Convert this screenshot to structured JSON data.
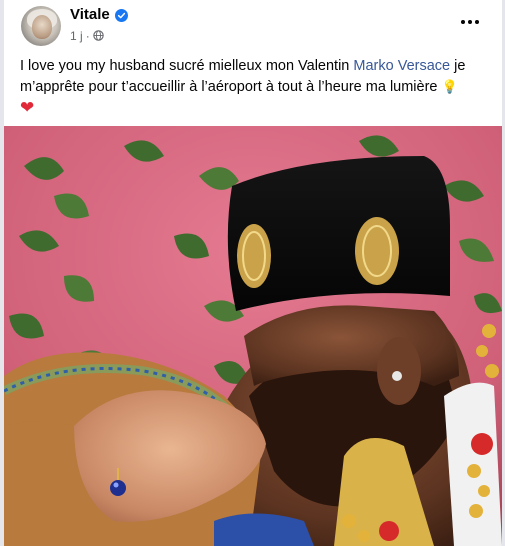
{
  "post": {
    "author": "Vitale",
    "time": "1 j",
    "separator": "·",
    "text_before": "I love you my husband sucré mielleux mon Valentin ",
    "mention": "Marko Versace",
    "text_after": "  je m’apprête pour t’accueillir à l’aéroport à tout à l’heure ma lumière ",
    "bulb_emoji": "💡",
    "heart_emoji": "❤"
  },
  "icons": {
    "verified": "verified-badge-icon",
    "privacy": "globe-icon",
    "menu": "more-options-icon"
  },
  "colors": {
    "link": "#385898",
    "verified": "#1877f2",
    "backdrop": "#d86a82"
  }
}
